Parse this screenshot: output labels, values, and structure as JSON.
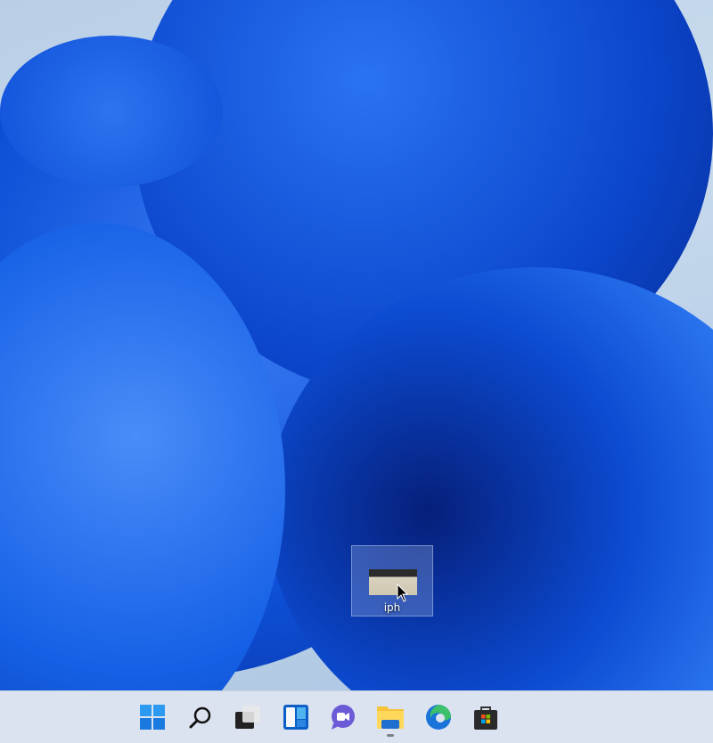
{
  "desktop": {
    "icons": [
      {
        "label": "iph",
        "icon": "image-file-thumbnail"
      }
    ]
  },
  "taskbar": {
    "items": [
      {
        "name": "start",
        "icon": "windows-logo-icon"
      },
      {
        "name": "search",
        "icon": "search-icon"
      },
      {
        "name": "task-view",
        "icon": "task-view-icon"
      },
      {
        "name": "widgets",
        "icon": "widgets-icon"
      },
      {
        "name": "chat",
        "icon": "teams-chat-icon"
      },
      {
        "name": "file-explorer",
        "icon": "folder-icon",
        "running": true
      },
      {
        "name": "edge",
        "icon": "edge-icon"
      },
      {
        "name": "store",
        "icon": "store-icon"
      }
    ]
  },
  "colors": {
    "accent": "#0f5fdc",
    "taskbar": "#dce3f0"
  }
}
